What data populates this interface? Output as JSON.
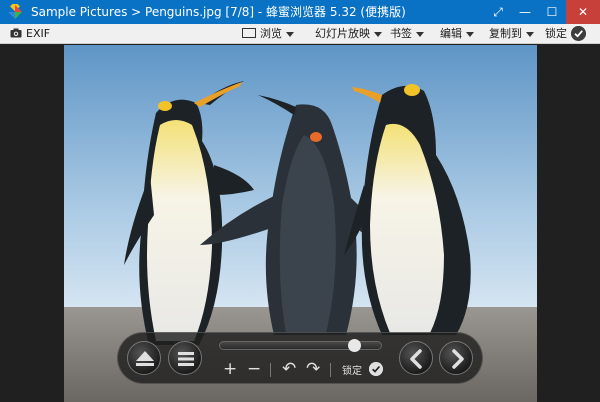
{
  "window": {
    "title": "Sample Pictures > Penguins.jpg [7/8] - 蜂蜜浏览器 5.32 (便携版)",
    "accent_color": "#0a72c4",
    "close_color": "#c8403a",
    "buttons": [
      {
        "icon": "fullscreen-icon",
        "glyph": "⤢"
      },
      {
        "icon": "minimize-icon",
        "glyph": "—"
      },
      {
        "icon": "maximize-icon",
        "glyph": "☐"
      },
      {
        "icon": "close-icon",
        "glyph": "✕"
      }
    ]
  },
  "toolbar": {
    "exif_label": "EXIF",
    "browse_label": "浏览",
    "slideshow_label": "幻灯片放映",
    "bookmarks_label": "书签",
    "edit_label": "编辑",
    "copy_to_label": "复制到",
    "lock_label": "锁定"
  },
  "viewer": {
    "image_subject": "Penguins.jpg",
    "controls": {
      "eject_icon": "eject-icon",
      "menu_icon": "menu-icon",
      "zoom_in_glyph": "+",
      "zoom_out_glyph": "−",
      "rotate_left_glyph": "↶",
      "rotate_right_glyph": "↷",
      "lock_label": "锁定",
      "prev_icon": "chevron-left-icon",
      "next_icon": "chevron-right-icon",
      "slider_position": 0.83
    }
  }
}
